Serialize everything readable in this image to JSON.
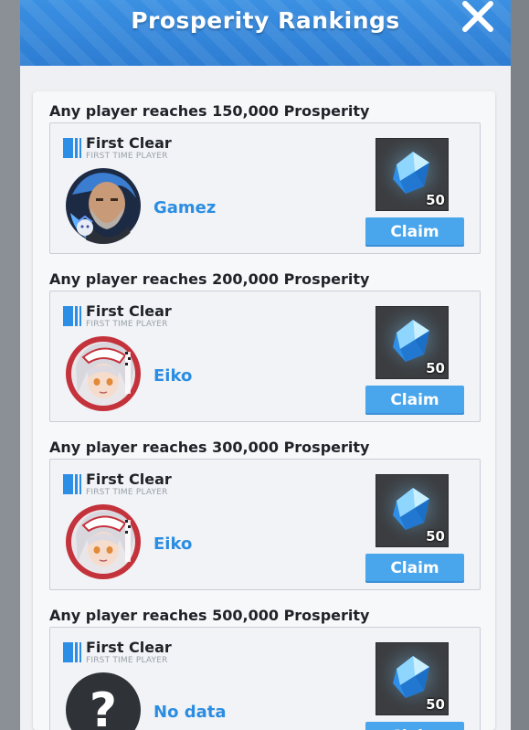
{
  "header": {
    "title": "Prosperity Rankings"
  },
  "rewards": [
    {
      "requirement": "Any player reaches 150,000 Prosperity",
      "clear_label": "First Clear",
      "clear_sub": "FIRST TIME PLAYER",
      "player": "Gamez",
      "avatar": "bald-man-avatar",
      "reward_icon": "blue-crystal-icon",
      "reward_qty": "50",
      "claim_label": "Claim"
    },
    {
      "requirement": "Any player reaches 200,000 Prosperity",
      "clear_label": "First Clear",
      "clear_sub": "FIRST TIME PLAYER",
      "player": "Eiko",
      "avatar": "white-haired-girl-avatar",
      "reward_icon": "blue-crystal-icon",
      "reward_qty": "50",
      "claim_label": "Claim"
    },
    {
      "requirement": "Any player reaches 300,000 Prosperity",
      "clear_label": "First Clear",
      "clear_sub": "FIRST TIME PLAYER",
      "player": "Eiko",
      "avatar": "white-haired-girl-avatar",
      "reward_icon": "blue-crystal-icon",
      "reward_qty": "50",
      "claim_label": "Claim"
    },
    {
      "requirement": "Any player reaches 500,000 Prosperity",
      "clear_label": "First Clear",
      "clear_sub": "FIRST TIME PLAYER",
      "player": "No data",
      "avatar": "question-mark-avatar",
      "reward_icon": "blue-crystal-icon",
      "reward_qty": "50",
      "claim_label": "Claim"
    }
  ],
  "colors": {
    "header_blue": "#2f7fd4",
    "accent_blue": "#2b8de2",
    "button_blue": "#4aa6ec"
  }
}
